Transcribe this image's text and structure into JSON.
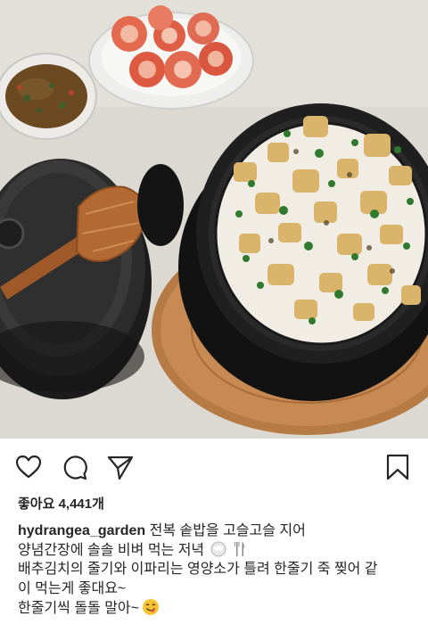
{
  "post": {
    "likes_text": "좋아요 4,441개",
    "username": "hydrangea_garden",
    "caption_line1": " 전복 솥밥을 고슬고슬 지어",
    "caption_line2": "양념간장에 솔솔 비벼 먹는 저녁",
    "caption_line3": "배추김치의 줄기와 이파리는 영양소가 틀려 한줄기 죽 찢어 같",
    "caption_line4": "이 먹는게 좋대요~",
    "caption_line5": "한줄기씩 돌돌 말아~"
  },
  "icons": {
    "like": "heart-icon",
    "comment": "comment-icon",
    "share": "share-icon",
    "save": "bookmark-icon",
    "emoji1": "rice-bowl-emoji",
    "emoji2": "fork-and-knife-emoji",
    "emoji3": "yum-face-emoji"
  },
  "colors": {
    "text": "#262626",
    "pot": "#1d1d1d",
    "rice": "#f1ede4",
    "kimchi": "#e0654b"
  }
}
